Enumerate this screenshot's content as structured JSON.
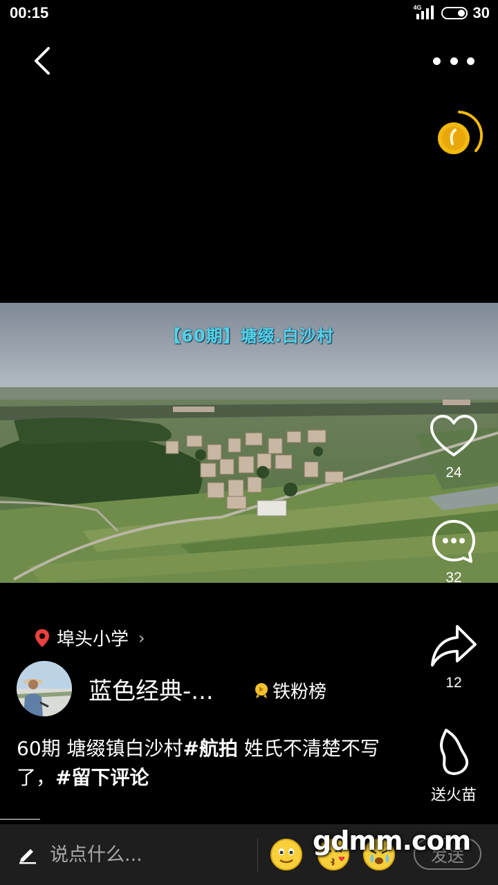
{
  "status_bar": {
    "time": "00:15",
    "network": "4G",
    "battery": "30"
  },
  "nav": {
    "back_icon": "chevron-left-icon",
    "more_icon": "more-dots-icon"
  },
  "video": {
    "caption": "【60期】塘缀.白沙村"
  },
  "actions": {
    "like_count": "24",
    "comment_count": "32",
    "share_count": "12",
    "fire_label": "送火苗"
  },
  "location": {
    "label": "埠头小学"
  },
  "author": {
    "name": "蓝色经典-...",
    "badge": "铁粉榜"
  },
  "description": {
    "part1": "60期 塘缀镇白沙村",
    "tag1": "#航拍",
    "part2": "  姓氏不清楚不写了，",
    "tag2": "#留下评论"
  },
  "comment_bar": {
    "placeholder": "说点什么...",
    "send_label": "发送"
  },
  "watermark": "gdmm.com",
  "colors": {
    "background": "#000000",
    "caption": "#53d3e6",
    "location_pin": "#e8413e",
    "coin": "#f2b90f"
  }
}
